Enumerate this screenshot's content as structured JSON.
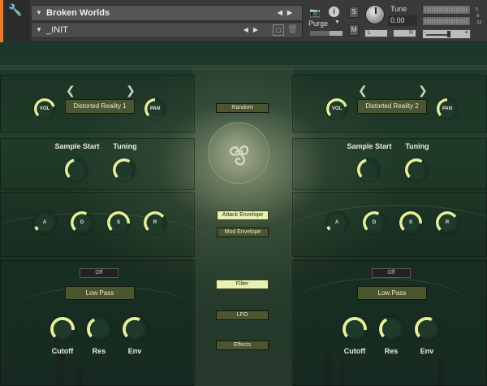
{
  "header": {
    "instrument_name": "Broken Worlds",
    "preset_name": "_INIT",
    "purge_label": "Purge",
    "tune_label": "Tune",
    "tune_value": "0.00",
    "solo_label": "S",
    "mute_label": "M",
    "pan_left": "L",
    "pan_right": "R",
    "vol_minus": "-",
    "vol_plus": "+",
    "info_label": "i",
    "side_labels": [
      "0",
      "-6",
      "-12"
    ]
  },
  "layer1": {
    "preset": "Distorted Reality 1",
    "vol_label": "VOL",
    "pan_label": "PAN",
    "sample_start_label": "Sample Start",
    "tuning_label": "Tuning",
    "adsr_labels": [
      "A",
      "D",
      "S",
      "R"
    ],
    "filter_toggle": "Off",
    "filter_type": "Low Pass",
    "cutoff_label": "Cutoff",
    "res_label": "Res",
    "env_label": "Env"
  },
  "layer2": {
    "preset": "Distorted Reality 2",
    "vol_label": "VOL",
    "pan_label": "PAN",
    "sample_start_label": "Sample Start",
    "tuning_label": "Tuning",
    "adsr_labels": [
      "A",
      "D",
      "S",
      "R"
    ],
    "filter_toggle": "Off",
    "filter_type": "Low Pass",
    "cutoff_label": "Cutoff",
    "res_label": "Res",
    "env_label": "Env"
  },
  "center": {
    "random": "Random",
    "attack_envelope": "Attack Envelope",
    "mod_envelope": "Mod Envelope",
    "filter": "Filter",
    "lfo": "LFO",
    "effects": "Effects"
  },
  "knob_levels": {
    "vol": 0.78,
    "pan": 0.5,
    "sample_start": 0.45,
    "tuning": 0.62,
    "attack": 0.08,
    "decay": 0.6,
    "sustain": 0.85,
    "release": 0.7,
    "cutoff": 0.85,
    "res": 0.4,
    "env": 0.6
  },
  "colors": {
    "accent": "#e6ee9a",
    "track": "#1a3226",
    "button_lit": "#e9f1b2",
    "panel_box": "#4a5631",
    "header_accent": "#e87b2c"
  }
}
